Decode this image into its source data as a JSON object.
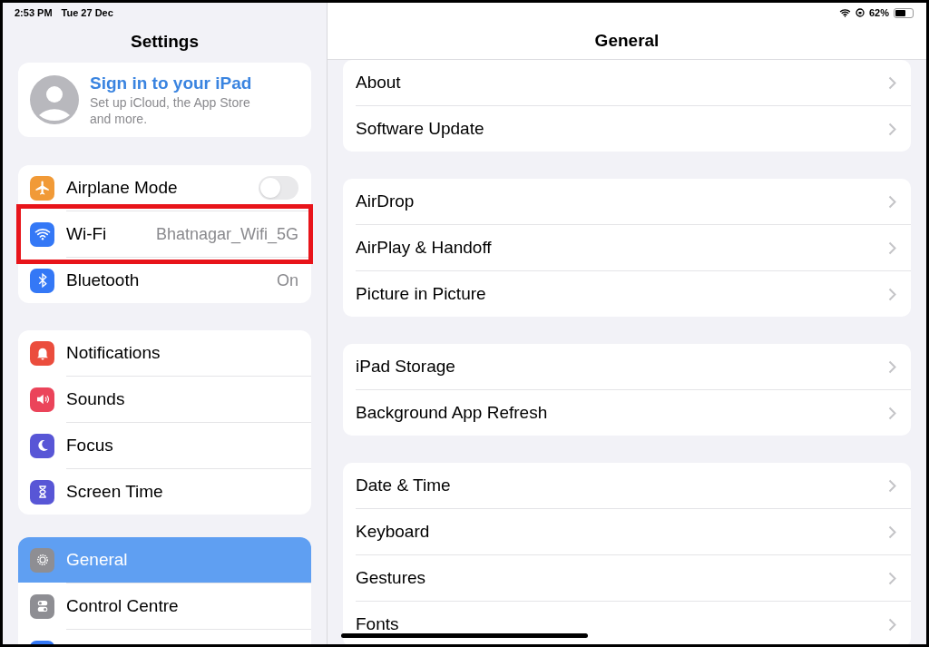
{
  "status_bar": {
    "time": "2:53 PM",
    "date": "Tue 27 Dec",
    "battery": "62%"
  },
  "sidebar": {
    "title": "Settings",
    "account": {
      "title": "Sign in to your iPad",
      "subtitle": "Set up iCloud, the App Store and more."
    },
    "groups": [
      [
        {
          "kind": "toggle",
          "label": "Airplane Mode",
          "color": "#f19a37",
          "on": false,
          "selected": false,
          "highlighted": false
        },
        {
          "kind": "value",
          "label": "Wi-Fi",
          "value": "Bhatnagar_Wifi_5G",
          "color": "#3478f6",
          "selected": false,
          "highlighted": true
        },
        {
          "kind": "value",
          "label": "Bluetooth",
          "value": "On",
          "color": "#3478f6",
          "selected": false,
          "highlighted": false
        }
      ],
      [
        {
          "kind": "nav",
          "label": "Notifications",
          "color": "#eb4d3d",
          "selected": false,
          "highlighted": false
        },
        {
          "kind": "nav",
          "label": "Sounds",
          "color": "#eb445a",
          "selected": false,
          "highlighted": false
        },
        {
          "kind": "nav",
          "label": "Focus",
          "color": "#5856d6",
          "selected": false,
          "highlighted": false
        },
        {
          "kind": "nav",
          "label": "Screen Time",
          "color": "#5856d6",
          "selected": false,
          "highlighted": false
        }
      ],
      [
        {
          "kind": "nav",
          "label": "General",
          "color": "#8e8e93",
          "selected": true,
          "highlighted": false
        },
        {
          "kind": "nav",
          "label": "Control Centre",
          "color": "#8e8e93",
          "selected": false,
          "highlighted": false
        },
        {
          "kind": "nav",
          "color": "#3478f6",
          "selected": false,
          "highlighted": false
        }
      ]
    ]
  },
  "detail": {
    "title": "General",
    "groups": [
      [
        "About",
        "Software Update"
      ],
      [
        "AirDrop",
        "AirPlay & Handoff",
        "Picture in Picture"
      ],
      [
        "iPad Storage",
        "Background App Refresh"
      ],
      [
        "Date & Time",
        "Keyboard",
        "Gestures",
        "Fonts"
      ]
    ]
  }
}
